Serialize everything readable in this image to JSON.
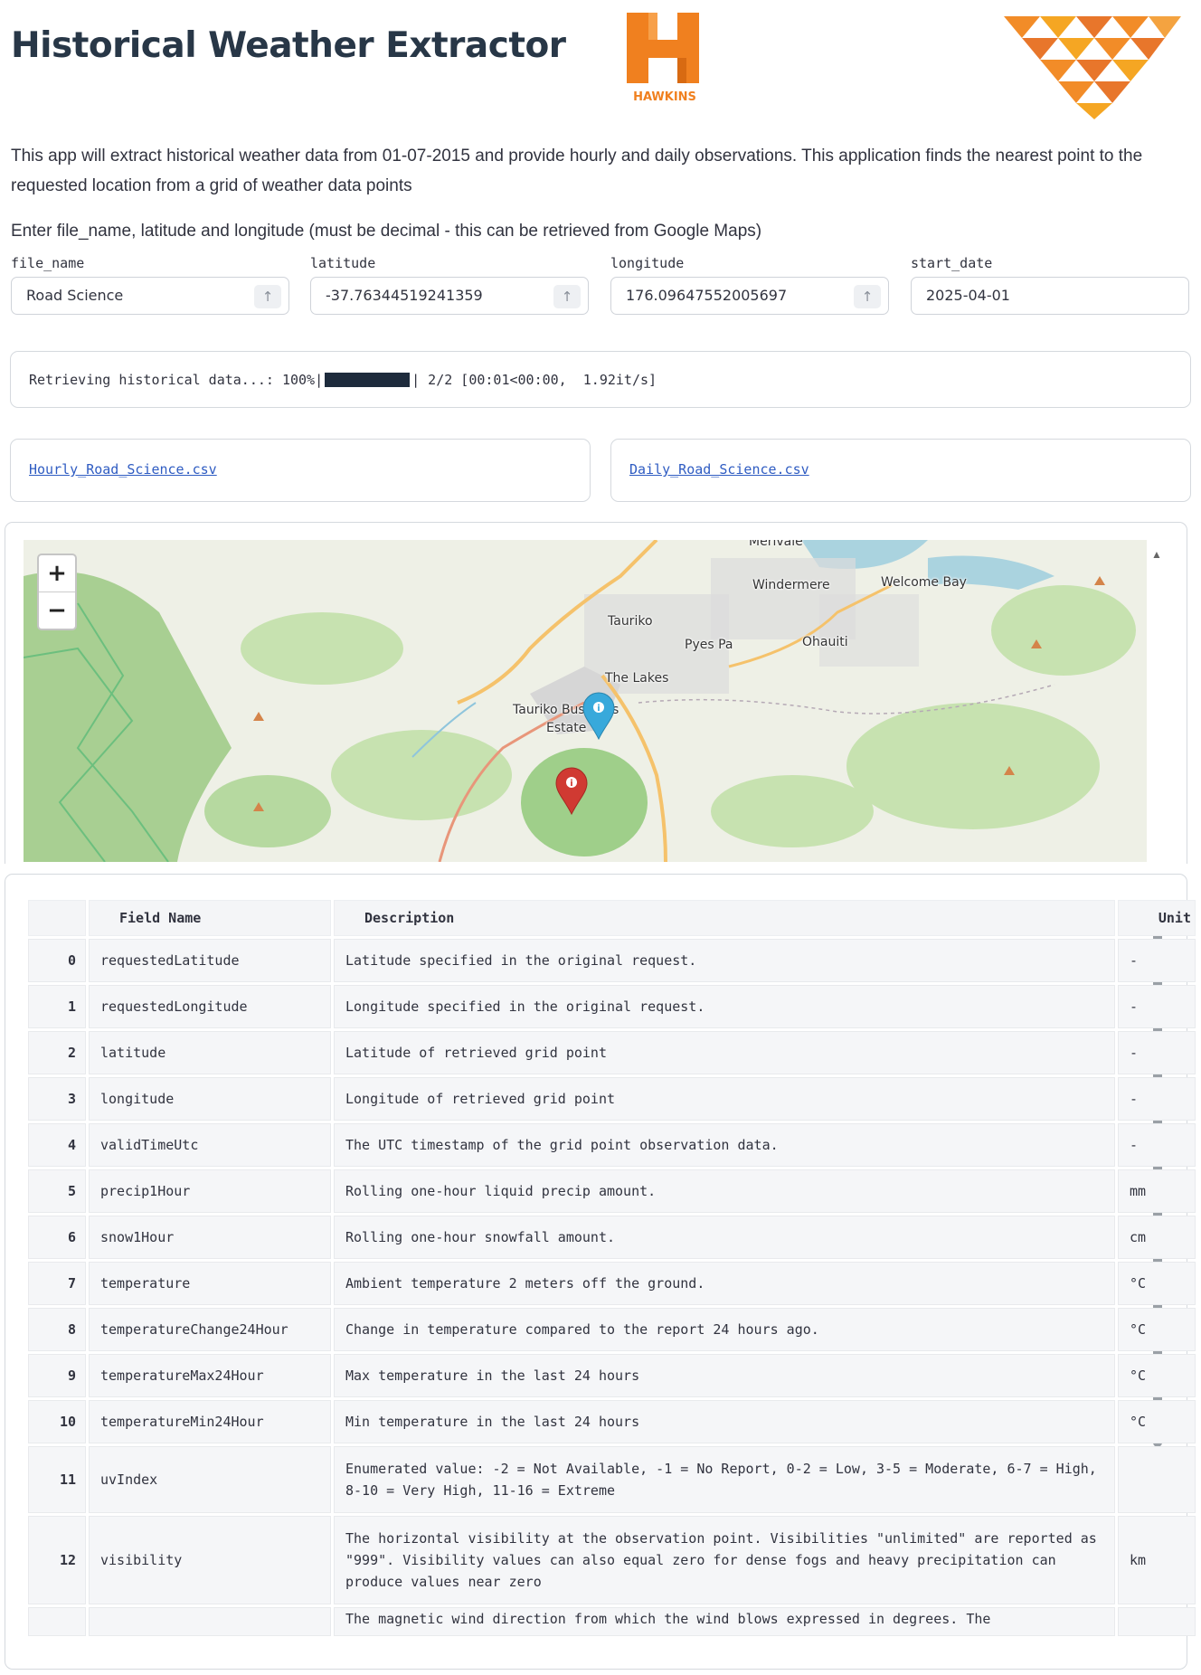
{
  "title": "Historical Weather Extractor",
  "logo": {
    "text": "HAWKINS",
    "color": "#f0801f"
  },
  "intro": "This app will extract historical weather data from 01-07-2015 and provide hourly and daily observations. This application finds the nearest point to the requested location from a grid of weather data points",
  "prompt": "Enter file_name, latitude and longitude (must be decimal - this can be retrieved from Google Maps)",
  "inputs": {
    "file_name": {
      "label": "file_name",
      "value": "Road Science"
    },
    "latitude": {
      "label": "latitude",
      "value": "-37.76344519241359"
    },
    "longitude": {
      "label": "longitude",
      "value": "176.09647552005697"
    },
    "start_date": {
      "label": "start_date",
      "value": "2025-04-01"
    }
  },
  "progress": {
    "prefix": "Retrieving historical data...: 100%|",
    "suffix": "| 2/2 [00:01<00:00,  1.92it/s]",
    "fraction": 1.0
  },
  "downloads": {
    "hourly": "Hourly_Road_Science.csv",
    "daily": "Daily_Road_Science.csv"
  },
  "map": {
    "zoom_in": "+",
    "zoom_out": "−",
    "labels": {
      "merivale": "Merivale",
      "windermere": "Windermere",
      "welcome_bay": "Welcome Bay",
      "tauriko": "Tauriko",
      "pyes_pa": "Pyes Pa",
      "ohauiti": "Ohauiti",
      "the_lakes": "The Lakes",
      "tauriko_bus": "Tauriko Bus",
      "s": "s",
      "estate": "Estate"
    },
    "markers": [
      {
        "color": "#38a9db",
        "icon": "info-icon"
      },
      {
        "color": "#d03a32",
        "icon": "info-icon"
      }
    ]
  },
  "table": {
    "headers": {
      "index": "",
      "field": "Field Name",
      "desc": "Description",
      "unit": "Unit"
    },
    "rows": [
      {
        "i": "0",
        "field": "requestedLatitude",
        "desc": "Latitude specified in the original request.",
        "unit": "-"
      },
      {
        "i": "1",
        "field": "requestedLongitude",
        "desc": "Longitude specified in the original request.",
        "unit": "-"
      },
      {
        "i": "2",
        "field": "latitude",
        "desc": "Latitude of retrieved grid point",
        "unit": "-"
      },
      {
        "i": "3",
        "field": "longitude",
        "desc": "Longitude of retrieved grid point",
        "unit": "-"
      },
      {
        "i": "4",
        "field": "validTimeUtc",
        "desc": "The UTC timestamp of the grid point observation data.",
        "unit": "-"
      },
      {
        "i": "5",
        "field": "precip1Hour",
        "desc": "Rolling one-hour liquid precip amount.",
        "unit": "mm"
      },
      {
        "i": "6",
        "field": "snow1Hour",
        "desc": "Rolling one-hour snowfall amount.",
        "unit": "cm"
      },
      {
        "i": "7",
        "field": "temperature",
        "desc": "Ambient temperature 2 meters off the ground.",
        "unit": "°C"
      },
      {
        "i": "8",
        "field": "temperatureChange24Hour",
        "desc": "Change in temperature compared to the report 24 hours ago.",
        "unit": "°C"
      },
      {
        "i": "9",
        "field": "temperatureMax24Hour",
        "desc": "Max temperature in the last 24 hours",
        "unit": "°C"
      },
      {
        "i": "10",
        "field": "temperatureMin24Hour",
        "desc": "Min temperature in the last 24 hours",
        "unit": "°C"
      },
      {
        "i": "11",
        "field": "uvIndex",
        "desc": "Enumerated value: -2 = Not Available, -1 = No Report, 0-2 = Low, 3-5 = Moderate, 6-7 = High, 8-10 = Very High, 11-16 = Extreme",
        "unit": ""
      },
      {
        "i": "12",
        "field": "visibility",
        "desc": "The horizontal visibility at the observation point. Visibilities \"unlimited\" are reported as \"999\". Visibility values can also equal zero for dense fogs and heavy precipitation can produce values near zero",
        "unit": "km"
      },
      {
        "i": "",
        "field": "",
        "desc": "The magnetic wind direction from which the wind blows expressed in degrees. The",
        "unit": ""
      }
    ]
  }
}
